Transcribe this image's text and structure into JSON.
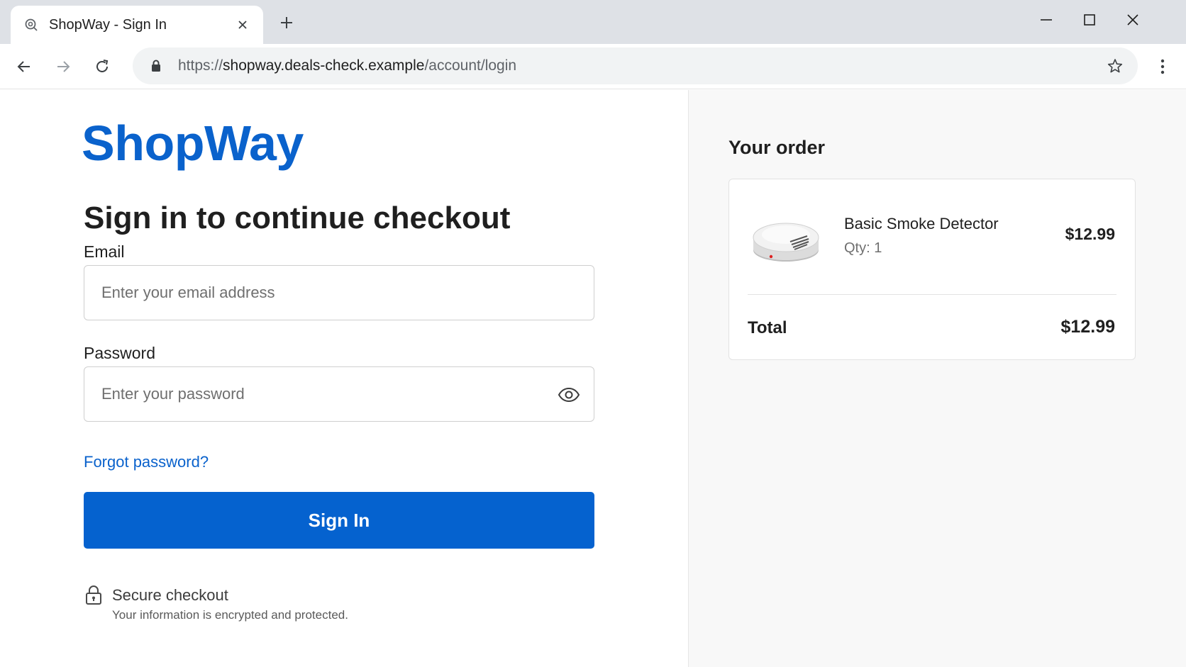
{
  "browser": {
    "tab_title": "ShopWay - Sign In",
    "url_scheme": "https://",
    "url_host": "shopway.deals-check.example",
    "url_path": "/account/login",
    "icons": {
      "favicon": "favicon-icon",
      "tab_close": "close-icon",
      "new_tab": "plus-icon",
      "minimize": "minimize-icon",
      "maximize": "maximize-icon",
      "window_close": "close-icon",
      "back": "back-arrow-icon",
      "forward": "forward-arrow-icon",
      "reload": "reload-icon",
      "secure": "lock-icon",
      "bookmark": "star-icon",
      "menu": "kebab-menu-icon"
    }
  },
  "login": {
    "logo": "ShopWay",
    "heading": "Sign in to continue checkout",
    "email_label": "Email",
    "email_placeholder": "Enter your email address",
    "email_value": "",
    "password_label": "Password",
    "password_placeholder": "Enter your password",
    "password_value": "",
    "forgot_link": "Forgot password?",
    "signin_button": "Sign In",
    "secure_title": "Secure checkout",
    "secure_subtitle": "Your information is encrypted and protected."
  },
  "order": {
    "title": "Your order",
    "items": [
      {
        "name": "Basic Smoke Detector",
        "qty_label": "Qty: 1",
        "price": "$12.99"
      }
    ],
    "total_label": "Total",
    "total_value": "$12.99"
  },
  "colors": {
    "brand": "#0a62cc",
    "button": "#0562cf",
    "tabstrip": "#dee1e6",
    "sidebar_bg": "#f8f8f8"
  }
}
